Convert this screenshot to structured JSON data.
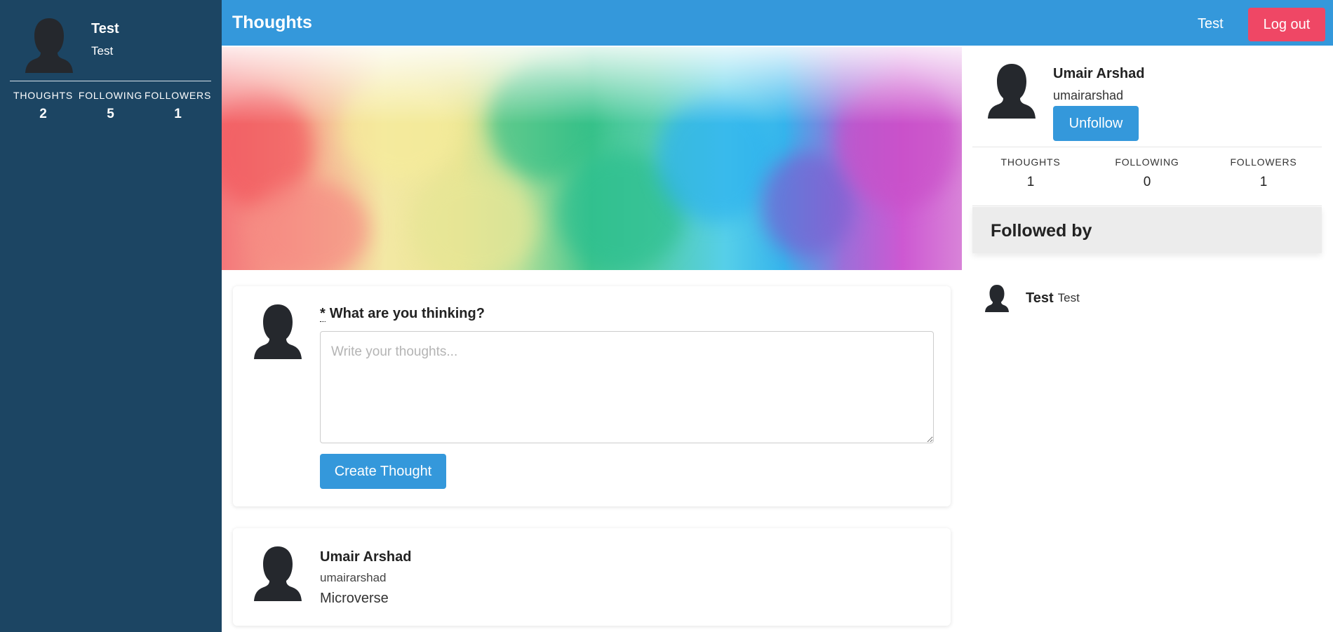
{
  "sidebar": {
    "name": "Test",
    "username": "Test",
    "stats": [
      {
        "label": "THOUGHTS",
        "value": "2"
      },
      {
        "label": "FOLLOWING",
        "value": "5"
      },
      {
        "label": "FOLLOWERS",
        "value": "1"
      }
    ]
  },
  "navbar": {
    "brand": "Thoughts",
    "user_link": "Test",
    "logout_label": "Log out"
  },
  "form": {
    "required_mark": "*",
    "label": "What are you thinking?",
    "placeholder": "Write your thoughts...",
    "submit_label": "Create Thought"
  },
  "thoughts": [
    {
      "name": "Umair Arshad",
      "username": "umairarshad",
      "text": "Microverse"
    }
  ],
  "profile": {
    "name": "Umair Arshad",
    "username": "umairarshad",
    "unfollow_label": "Unfollow",
    "stats": [
      {
        "label": "THOUGHTS",
        "value": "1"
      },
      {
        "label": "FOLLOWING",
        "value": "0"
      },
      {
        "label": "FOLLOWERS",
        "value": "1"
      }
    ],
    "followed_by_title": "Followed by",
    "followers": [
      {
        "name": "Test",
        "username": "Test"
      }
    ]
  },
  "colors": {
    "sidebar_bg": "#1c4563",
    "navbar_bg": "#3498db",
    "logout_bg": "#ef4765",
    "button_bg": "#3498db",
    "avatar": "#25282d"
  },
  "icons": {
    "avatar": "person-silhouette-icon"
  }
}
